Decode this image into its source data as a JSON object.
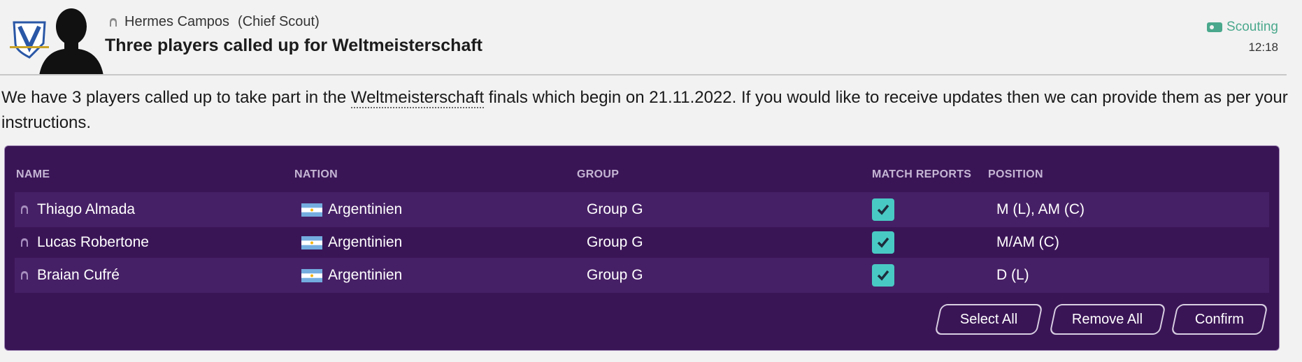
{
  "message": {
    "sender_name": "Hermes Campos",
    "sender_role": "(Chief Scout)",
    "subject": "Three players called up for Weltmeisterschaft",
    "category": "Scouting",
    "time": "12:18",
    "body_before_link": "We have 3 players called up to take part in the ",
    "body_link": "Weltmeisterschaft",
    "body_after_link": " finals which begin on 21.11.2022. If you would like to receive updates then we can provide them as per your instructions."
  },
  "table": {
    "headers": {
      "name": "NAME",
      "nation": "NATION",
      "group": "GROUP",
      "match_reports": "MATCH REPORTS",
      "position": "POSITION"
    },
    "rows": [
      {
        "name": "Thiago Almada",
        "nation": "Argentinien",
        "group": "Group G",
        "match_reports": true,
        "position": "M (L), AM (C)"
      },
      {
        "name": "Lucas Robertone",
        "nation": "Argentinien",
        "group": "Group G",
        "match_reports": true,
        "position": "M/AM (C)"
      },
      {
        "name": "Braian Cufré",
        "nation": "Argentinien",
        "group": "Group G",
        "match_reports": true,
        "position": "D (L)"
      }
    ]
  },
  "buttons": {
    "select_all": "Select All",
    "remove_all": "Remove All",
    "confirm": "Confirm"
  },
  "colors": {
    "panel_bg": "#3a1556",
    "row_bg": "#462066",
    "checkbox": "#49c9c4",
    "category_text": "#4aa88c"
  }
}
